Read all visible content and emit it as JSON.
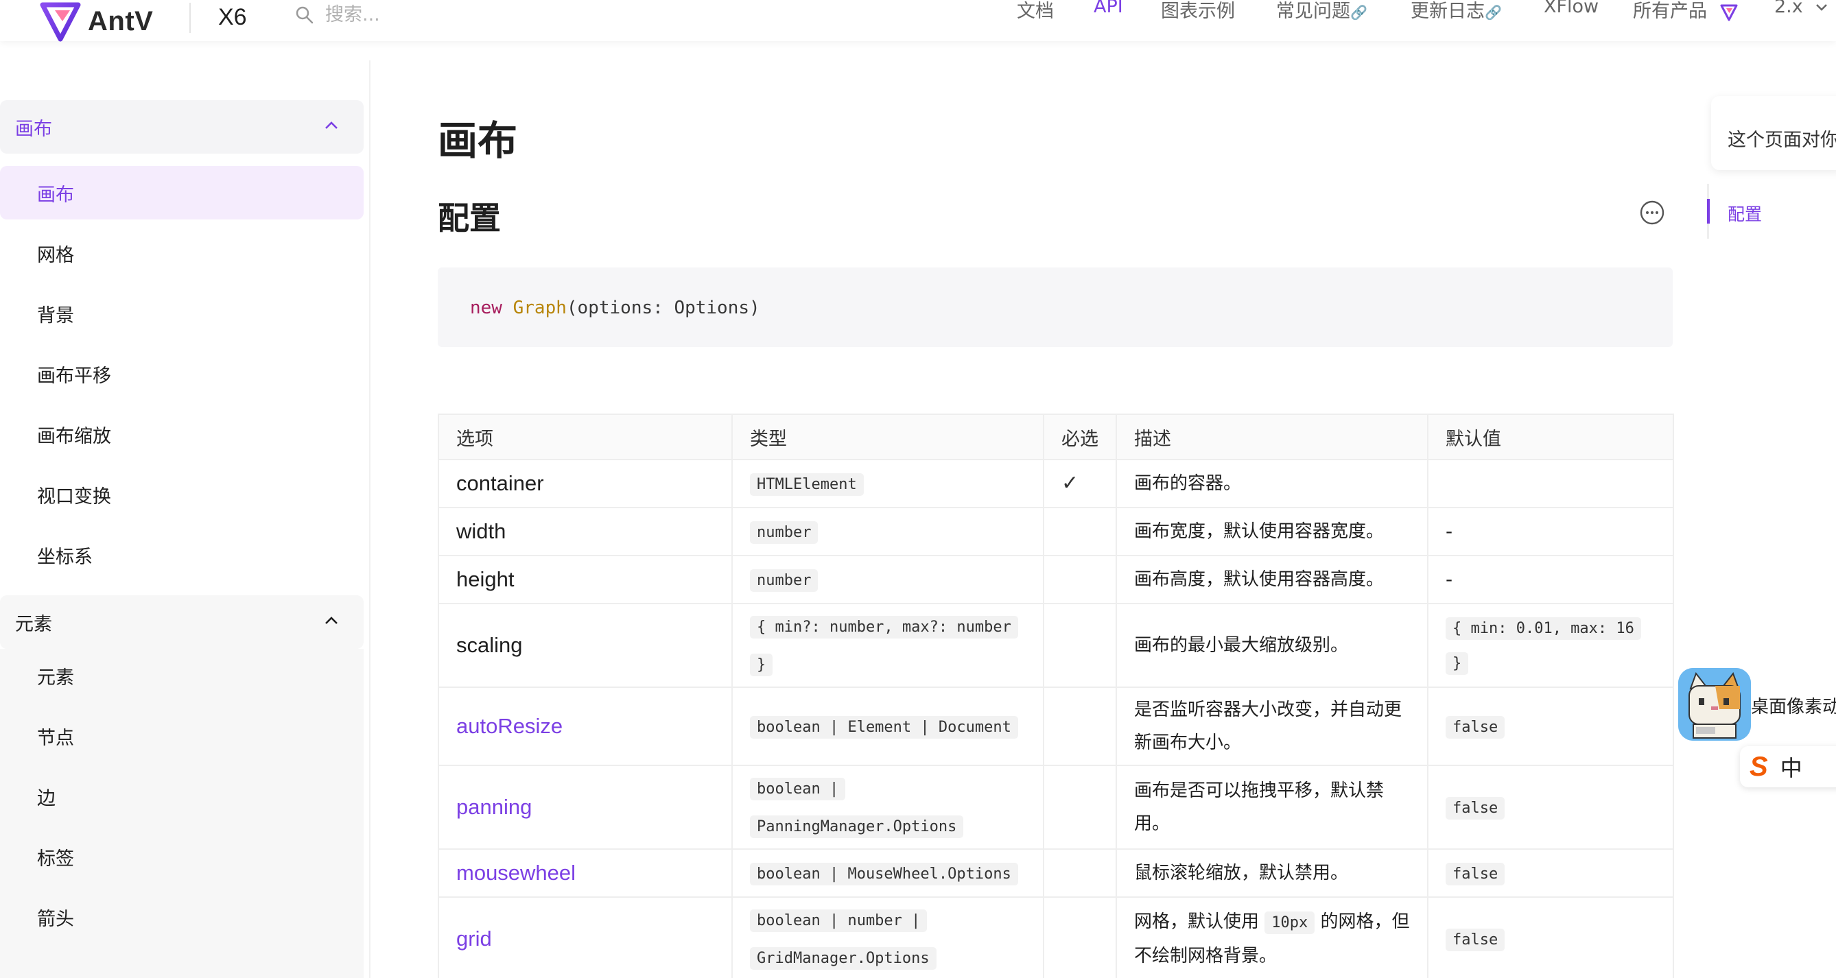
{
  "header": {
    "brand": "AntV",
    "product": "X6",
    "search_placeholder": "搜索...",
    "nav": [
      {
        "label": "文档",
        "active": false,
        "external": false
      },
      {
        "label": "API",
        "active": true,
        "external": false
      },
      {
        "label": "图表示例",
        "active": false,
        "external": false
      },
      {
        "label": "常见问题",
        "active": false,
        "external": true
      },
      {
        "label": "更新日志",
        "active": false,
        "external": true
      },
      {
        "label": "XFlow",
        "active": false,
        "external": false
      },
      {
        "label": "所有产品",
        "active": false,
        "external": false
      },
      {
        "label": "2.x",
        "active": false,
        "external": false
      }
    ]
  },
  "sidebar": {
    "groups": [
      {
        "label": "画布",
        "active": true,
        "items": [
          "画布",
          "网格",
          "背景",
          "画布平移",
          "画布缩放",
          "视口变换",
          "坐标系"
        ],
        "selected": "画布"
      },
      {
        "label": "元素",
        "active": false,
        "items": [
          "元素",
          "节点",
          "边",
          "标签",
          "箭头"
        ]
      }
    ]
  },
  "main": {
    "title": "画布",
    "section": "配置",
    "code": {
      "kw": "new",
      "fn": "Graph",
      "rest": "(options: Options)"
    },
    "table": {
      "headers": [
        "选项",
        "类型",
        "必选",
        "描述",
        "默认值"
      ],
      "rows": [
        {
          "option": "container",
          "link": false,
          "type": "HTMLElement",
          "required": "✓",
          "desc": "画布的容器。",
          "default": ""
        },
        {
          "option": "width",
          "link": false,
          "type": "number",
          "required": "",
          "desc": "画布宽度，默认使用容器宽度。",
          "default": "-"
        },
        {
          "option": "height",
          "link": false,
          "type": "number",
          "required": "",
          "desc": "画布高度，默认使用容器高度。",
          "default": "-"
        },
        {
          "option": "scaling",
          "link": false,
          "type": "{ min?: number, max?: number }",
          "required": "",
          "desc": "画布的最小最大缩放级别。",
          "default": "{ min: 0.01, max: 16 }"
        },
        {
          "option": "autoResize",
          "link": true,
          "type": "boolean | Element | Document",
          "required": "",
          "desc": "是否监听容器大小改变，并自动更新画布大小。",
          "default": "false"
        },
        {
          "option": "panning",
          "link": true,
          "type": "boolean | PanningManager.Options",
          "required": "",
          "desc": "画布是否可以拖拽平移，默认禁用。",
          "default": "false"
        },
        {
          "option": "mousewheel",
          "link": true,
          "type": "boolean | MouseWheel.Options",
          "required": "",
          "desc": "鼠标滚轮缩放，默认禁用。",
          "default": "false"
        },
        {
          "option": "grid",
          "link": true,
          "type": "boolean | number | GridManager.Options",
          "required": "",
          "desc_pre": "网格，默认使用 ",
          "desc_code": "10px",
          "desc_post": " 的网格，但不绘制网格背景。",
          "default": "false"
        }
      ]
    }
  },
  "toc": {
    "feedback": "这个页面对你有帮助吗？",
    "items": [
      "配置"
    ]
  },
  "widgets": {
    "pet_label": "桌面像素动物",
    "ime_logo": "S",
    "ime_mode": "中"
  },
  "colors": {
    "accent": "#7b3fe4",
    "text": "#1f1f1f",
    "muted": "#666666"
  }
}
